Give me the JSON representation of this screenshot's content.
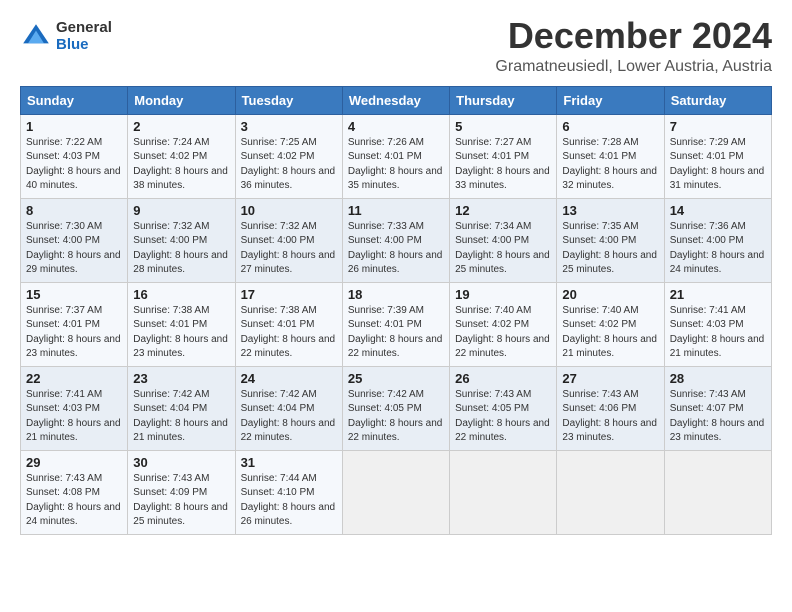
{
  "header": {
    "logo_general": "General",
    "logo_blue": "Blue",
    "month": "December 2024",
    "location": "Gramatneusiedl, Lower Austria, Austria"
  },
  "weekdays": [
    "Sunday",
    "Monday",
    "Tuesday",
    "Wednesday",
    "Thursday",
    "Friday",
    "Saturday"
  ],
  "weeks": [
    [
      {
        "day": "1",
        "sunrise": "Sunrise: 7:22 AM",
        "sunset": "Sunset: 4:03 PM",
        "daylight": "Daylight: 8 hours and 40 minutes."
      },
      {
        "day": "2",
        "sunrise": "Sunrise: 7:24 AM",
        "sunset": "Sunset: 4:02 PM",
        "daylight": "Daylight: 8 hours and 38 minutes."
      },
      {
        "day": "3",
        "sunrise": "Sunrise: 7:25 AM",
        "sunset": "Sunset: 4:02 PM",
        "daylight": "Daylight: 8 hours and 36 minutes."
      },
      {
        "day": "4",
        "sunrise": "Sunrise: 7:26 AM",
        "sunset": "Sunset: 4:01 PM",
        "daylight": "Daylight: 8 hours and 35 minutes."
      },
      {
        "day": "5",
        "sunrise": "Sunrise: 7:27 AM",
        "sunset": "Sunset: 4:01 PM",
        "daylight": "Daylight: 8 hours and 33 minutes."
      },
      {
        "day": "6",
        "sunrise": "Sunrise: 7:28 AM",
        "sunset": "Sunset: 4:01 PM",
        "daylight": "Daylight: 8 hours and 32 minutes."
      },
      {
        "day": "7",
        "sunrise": "Sunrise: 7:29 AM",
        "sunset": "Sunset: 4:01 PM",
        "daylight": "Daylight: 8 hours and 31 minutes."
      }
    ],
    [
      {
        "day": "8",
        "sunrise": "Sunrise: 7:30 AM",
        "sunset": "Sunset: 4:00 PM",
        "daylight": "Daylight: 8 hours and 29 minutes."
      },
      {
        "day": "9",
        "sunrise": "Sunrise: 7:32 AM",
        "sunset": "Sunset: 4:00 PM",
        "daylight": "Daylight: 8 hours and 28 minutes."
      },
      {
        "day": "10",
        "sunrise": "Sunrise: 7:32 AM",
        "sunset": "Sunset: 4:00 PM",
        "daylight": "Daylight: 8 hours and 27 minutes."
      },
      {
        "day": "11",
        "sunrise": "Sunrise: 7:33 AM",
        "sunset": "Sunset: 4:00 PM",
        "daylight": "Daylight: 8 hours and 26 minutes."
      },
      {
        "day": "12",
        "sunrise": "Sunrise: 7:34 AM",
        "sunset": "Sunset: 4:00 PM",
        "daylight": "Daylight: 8 hours and 25 minutes."
      },
      {
        "day": "13",
        "sunrise": "Sunrise: 7:35 AM",
        "sunset": "Sunset: 4:00 PM",
        "daylight": "Daylight: 8 hours and 25 minutes."
      },
      {
        "day": "14",
        "sunrise": "Sunrise: 7:36 AM",
        "sunset": "Sunset: 4:00 PM",
        "daylight": "Daylight: 8 hours and 24 minutes."
      }
    ],
    [
      {
        "day": "15",
        "sunrise": "Sunrise: 7:37 AM",
        "sunset": "Sunset: 4:01 PM",
        "daylight": "Daylight: 8 hours and 23 minutes."
      },
      {
        "day": "16",
        "sunrise": "Sunrise: 7:38 AM",
        "sunset": "Sunset: 4:01 PM",
        "daylight": "Daylight: 8 hours and 23 minutes."
      },
      {
        "day": "17",
        "sunrise": "Sunrise: 7:38 AM",
        "sunset": "Sunset: 4:01 PM",
        "daylight": "Daylight: 8 hours and 22 minutes."
      },
      {
        "day": "18",
        "sunrise": "Sunrise: 7:39 AM",
        "sunset": "Sunset: 4:01 PM",
        "daylight": "Daylight: 8 hours and 22 minutes."
      },
      {
        "day": "19",
        "sunrise": "Sunrise: 7:40 AM",
        "sunset": "Sunset: 4:02 PM",
        "daylight": "Daylight: 8 hours and 22 minutes."
      },
      {
        "day": "20",
        "sunrise": "Sunrise: 7:40 AM",
        "sunset": "Sunset: 4:02 PM",
        "daylight": "Daylight: 8 hours and 21 minutes."
      },
      {
        "day": "21",
        "sunrise": "Sunrise: 7:41 AM",
        "sunset": "Sunset: 4:03 PM",
        "daylight": "Daylight: 8 hours and 21 minutes."
      }
    ],
    [
      {
        "day": "22",
        "sunrise": "Sunrise: 7:41 AM",
        "sunset": "Sunset: 4:03 PM",
        "daylight": "Daylight: 8 hours and 21 minutes."
      },
      {
        "day": "23",
        "sunrise": "Sunrise: 7:42 AM",
        "sunset": "Sunset: 4:04 PM",
        "daylight": "Daylight: 8 hours and 21 minutes."
      },
      {
        "day": "24",
        "sunrise": "Sunrise: 7:42 AM",
        "sunset": "Sunset: 4:04 PM",
        "daylight": "Daylight: 8 hours and 22 minutes."
      },
      {
        "day": "25",
        "sunrise": "Sunrise: 7:42 AM",
        "sunset": "Sunset: 4:05 PM",
        "daylight": "Daylight: 8 hours and 22 minutes."
      },
      {
        "day": "26",
        "sunrise": "Sunrise: 7:43 AM",
        "sunset": "Sunset: 4:05 PM",
        "daylight": "Daylight: 8 hours and 22 minutes."
      },
      {
        "day": "27",
        "sunrise": "Sunrise: 7:43 AM",
        "sunset": "Sunset: 4:06 PM",
        "daylight": "Daylight: 8 hours and 23 minutes."
      },
      {
        "day": "28",
        "sunrise": "Sunrise: 7:43 AM",
        "sunset": "Sunset: 4:07 PM",
        "daylight": "Daylight: 8 hours and 23 minutes."
      }
    ],
    [
      {
        "day": "29",
        "sunrise": "Sunrise: 7:43 AM",
        "sunset": "Sunset: 4:08 PM",
        "daylight": "Daylight: 8 hours and 24 minutes."
      },
      {
        "day": "30",
        "sunrise": "Sunrise: 7:43 AM",
        "sunset": "Sunset: 4:09 PM",
        "daylight": "Daylight: 8 hours and 25 minutes."
      },
      {
        "day": "31",
        "sunrise": "Sunrise: 7:44 AM",
        "sunset": "Sunset: 4:10 PM",
        "daylight": "Daylight: 8 hours and 26 minutes."
      },
      {
        "day": "",
        "sunrise": "",
        "sunset": "",
        "daylight": ""
      },
      {
        "day": "",
        "sunrise": "",
        "sunset": "",
        "daylight": ""
      },
      {
        "day": "",
        "sunrise": "",
        "sunset": "",
        "daylight": ""
      },
      {
        "day": "",
        "sunrise": "",
        "sunset": "",
        "daylight": ""
      }
    ]
  ]
}
